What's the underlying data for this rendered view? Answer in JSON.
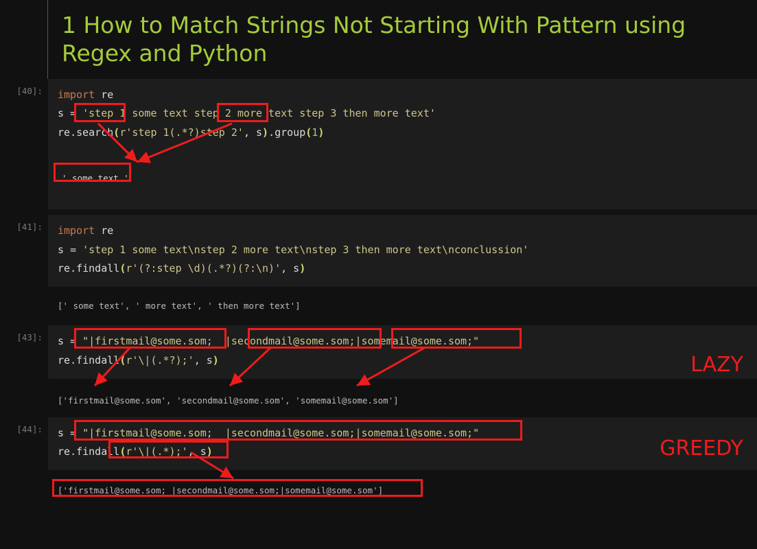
{
  "title": "1  How to Match Strings Not Starting With Pattern using Regex and Python",
  "cells": {
    "c40": {
      "prompt": "[40]:",
      "line1_import": "import",
      "line1_mod": " re",
      "line2_pre": "s = ",
      "line2_str_a": "'step 1 ",
      "line2_str_b": "some text ",
      "line2_str_c": "step 2 ",
      "line2_str_d": "more text step 3 then more text'",
      "line3": "re.search(r'step 1(.*?)step 2', s).group(1)",
      "output": "' some text '"
    },
    "c41": {
      "prompt": "[41]:",
      "line1_import": "import",
      "line1_mod": " re",
      "line2": "s = 'step 1 some text\\nstep 2 more text\\nstep 3 then more text\\nconclussion'",
      "line3": "re.findall(r'(?:step \\d)(.*?)(?:\\n)', s)",
      "output": "[' some text', ' more text', ' then more text']"
    },
    "c43": {
      "prompt": "[43]:",
      "line1": "s = \"|firstmail@some.som;  |secondmail@some.som;|somemail@some.som;\"",
      "line2": "re.findall(r'\\|(.*?);', s)",
      "output": "['firstmail@some.som', 'secondmail@some.som', 'somemail@some.som']",
      "label": "LAZY"
    },
    "c44": {
      "prompt": "[44]:",
      "line1": "s = \"|firstmail@some.som;  |secondmail@some.som;|somemail@some.som;\"",
      "line2": "re.findall(r'\\|(.*);', s)",
      "output": "['firstmail@some.som;  |secondmail@some.som;|somemail@some.som']",
      "label": "GREEDY"
    }
  }
}
